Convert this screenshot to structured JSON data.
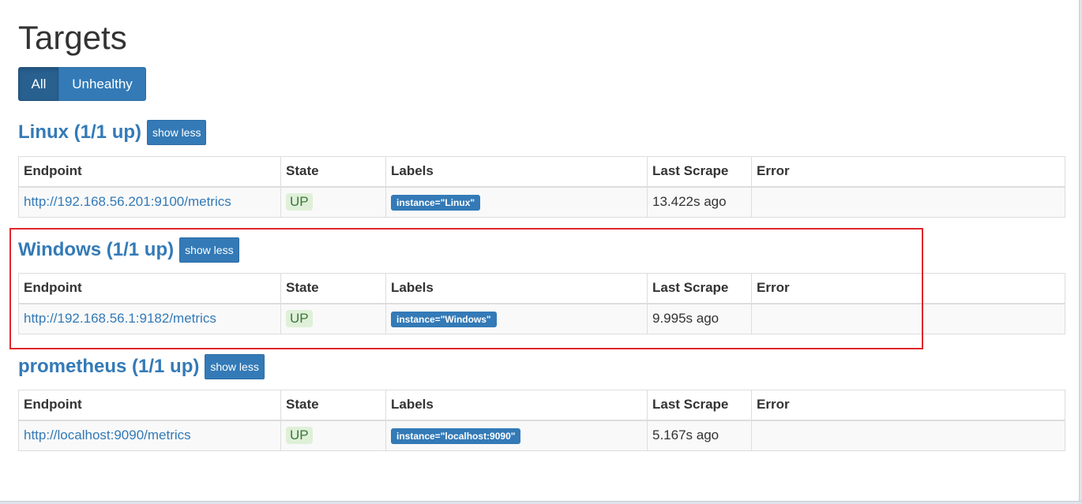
{
  "page": {
    "title": "Targets"
  },
  "filters": {
    "all_label": "All",
    "unhealthy_label": "Unhealthy"
  },
  "columns": {
    "endpoint": "Endpoint",
    "state": "State",
    "labels": "Labels",
    "last_scrape": "Last Scrape",
    "error": "Error"
  },
  "jobs": [
    {
      "title": "Linux (1/1 up)",
      "toggle": "show less",
      "target": {
        "endpoint": "http://192.168.56.201:9100/metrics",
        "state": "UP",
        "label": "instance=\"Linux\"",
        "last_scrape": "13.422s ago",
        "error": ""
      }
    },
    {
      "title": "Windows (1/1 up)",
      "toggle": "show less",
      "target": {
        "endpoint": "http://192.168.56.1:9182/metrics",
        "state": "UP",
        "label": "instance=\"Windows\"",
        "last_scrape": "9.995s ago",
        "error": ""
      }
    },
    {
      "title": "prometheus (1/1 up)",
      "toggle": "show less",
      "target": {
        "endpoint": "http://localhost:9090/metrics",
        "state": "UP",
        "label": "instance=\"localhost:9090\"",
        "last_scrape": "5.167s ago",
        "error": ""
      }
    }
  ],
  "colors": {
    "accent": "#337ab7",
    "up_bg": "#dff0d8",
    "up_text": "#3c763d",
    "highlight": "#e0262c"
  }
}
